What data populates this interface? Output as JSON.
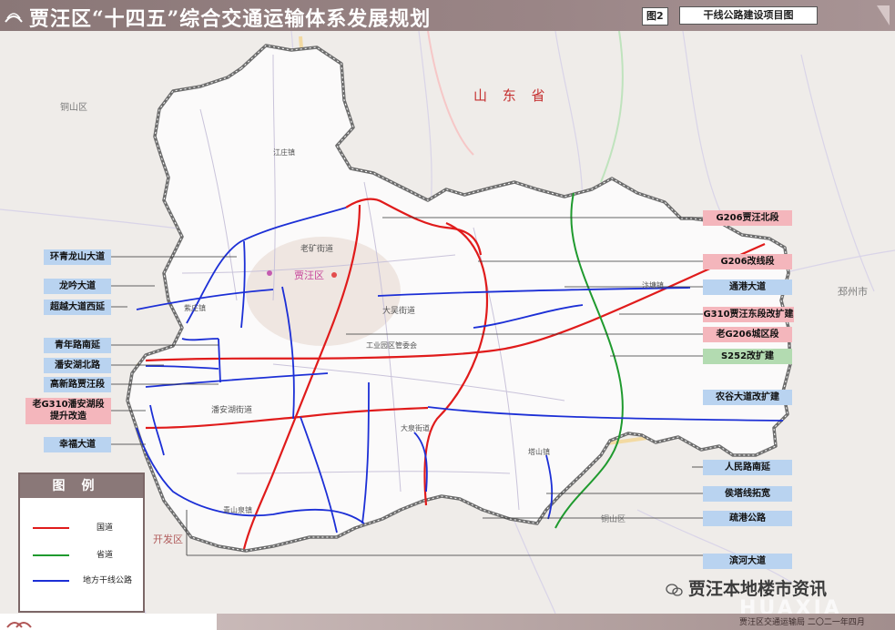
{
  "header": {
    "title": "贾汪区“十四五”综合交通运输体系发展规划",
    "figure_no": "图2",
    "figure_name": "干线公路建设项目图"
  },
  "map_labels": {
    "province": "山 东 省",
    "tongshan": "铜山区",
    "pizhou": "邳州市",
    "kaifa": "开发区",
    "jiawang": "贾汪区",
    "jiawang_st": "老矿街道",
    "dawu_st": "大吴街道",
    "pan_st": "潘安湖街道",
    "gongye_town": "工业园区管委会",
    "zizhuang": "紫庄镇",
    "jiangzhuang": "江庄镇",
    "qingshanquan": "青山泉镇",
    "tashan": "塔山镇",
    "biantang": "汴塘镇",
    "datun": "大泉街道",
    "tongshan2": "铜山区"
  },
  "callouts_left": [
    {
      "label": "环青龙山大道",
      "color": "blue"
    },
    {
      "label": "龙吟大道",
      "color": "blue"
    },
    {
      "label": "超越大道西延",
      "color": "blue"
    },
    {
      "label": "青年路南延",
      "color": "blue"
    },
    {
      "label": "潘安湖北路",
      "color": "blue"
    },
    {
      "label": "高新路贾汪段",
      "color": "blue"
    },
    {
      "label": "老G310潘安湖段",
      "label2": "提升改造",
      "color": "red"
    },
    {
      "label": "幸福大道",
      "color": "blue"
    }
  ],
  "callouts_right": [
    {
      "label": "G206贾汪北段",
      "color": "red"
    },
    {
      "label": "G206改线段",
      "color": "red"
    },
    {
      "label": "通港大道",
      "color": "blue"
    },
    {
      "label": "G310贾汪东段改扩建",
      "color": "red"
    },
    {
      "label": "老G206城区段",
      "color": "red"
    },
    {
      "label": "S252改扩建",
      "color": "green"
    },
    {
      "label": "农谷大道改扩建",
      "color": "blue"
    },
    {
      "label": "人民路南延",
      "color": "blue"
    },
    {
      "label": "侯塔线拓宽",
      "color": "blue"
    },
    {
      "label": "疏港公路",
      "color": "blue"
    },
    {
      "label": "滨河大道",
      "color": "blue"
    }
  ],
  "legend": {
    "title": "图例",
    "items": [
      {
        "label": "国道",
        "color": "#e01b1b"
      },
      {
        "label": "省道",
        "color": "#1f9a2e"
      },
      {
        "label": "地方干线公路",
        "color": "#1c2fd6"
      }
    ]
  },
  "footer": {
    "credit": "贾汪区交通运输局 二〇二一年四月"
  },
  "watermark": {
    "text": "贾汪本地楼市资讯",
    "site": "HUAXIA"
  },
  "colors": {
    "national_road": "#e01b1b",
    "provincial_road": "#1f9a2e",
    "local_road": "#1c2fd6",
    "header": "#8a7777"
  }
}
